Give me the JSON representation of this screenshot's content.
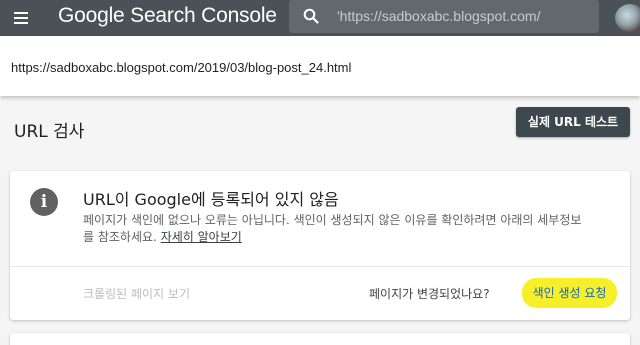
{
  "header": {
    "app_title": "Google Search Console",
    "search_value": "'https://sadboxabc.blogspot.com/"
  },
  "url_bar": {
    "url": "https://sadboxabc.blogspot.com/2019/03/blog-post_24.html"
  },
  "section": {
    "title": "URL 검사",
    "live_test_label": "실제 URL 테스트"
  },
  "status_card": {
    "icon": "info-icon",
    "title": "URL이 Google에 등록되어 있지 않음",
    "description": "페이지가 색인에 없으나 오류는 아닙니다. 색인이 생성되지 않은 이유를 확인하려면 아래의 세부정보를 참조하세요.",
    "learn_more": "자세히 알아보기",
    "view_crawled": "크롤링된 페이지 보기",
    "changed_question": "페이지가 변경되었나요?",
    "request_indexing": "색인 생성 요청"
  },
  "colors": {
    "topbar": "#4b5257",
    "highlight": "#f7ef2a",
    "link": "#1565c0"
  }
}
